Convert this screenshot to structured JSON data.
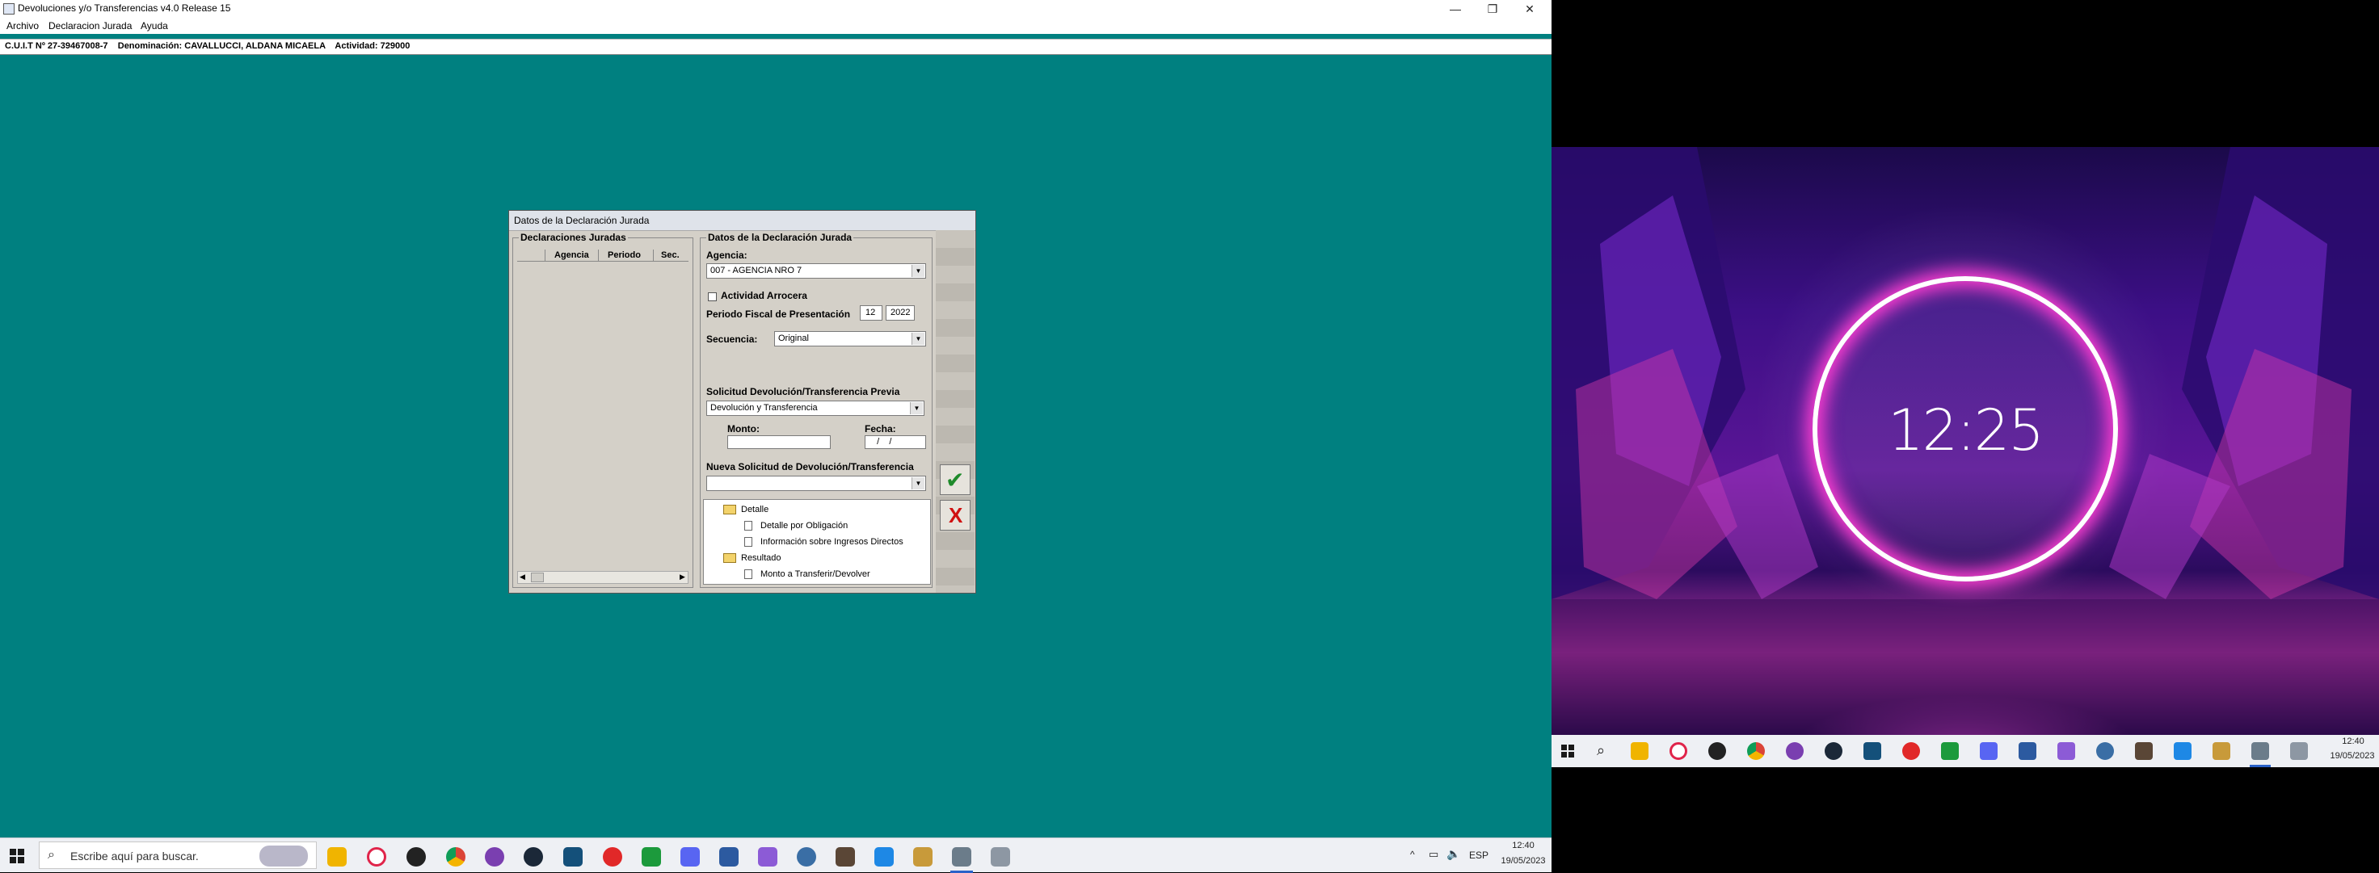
{
  "app": {
    "title": "Devoluciones y/o Transferencias v4.0 Release 15",
    "window_controls": [
      "—",
      "❐",
      "✕"
    ],
    "menu": [
      "Archivo",
      "Declaracion Jurada",
      "Ayuda"
    ],
    "infobar": "C.U.I.T Nº 27-39467008-7    Denominación: CAVALLUCCI, ALDANA MICAELA    Actividad: 729000"
  },
  "dialog": {
    "title": "Datos de la Declaración Jurada",
    "left_group": {
      "label": "Declaraciones Juradas",
      "columns": [
        "Agencia",
        "Periodo",
        "Sec."
      ]
    },
    "right_group": {
      "label": "Datos de la Declaración Jurada",
      "agencia_label": "Agencia:",
      "agencia_value": "007 - AGENCIA NRO 7",
      "actividad_arrocera_label": "Actividad Arrocera",
      "periodo_label": "Periodo Fiscal de Presentación",
      "periodo_month": "12",
      "periodo_year": "2022",
      "secuencia_label": "Secuencia:",
      "secuencia_value": "Original",
      "solicitud_previa_label": "Solicitud Devolución/Transferencia Previa",
      "solicitud_previa_value": "Devolución y Transferencia",
      "monto_label": "Monto:",
      "monto_value": "",
      "fecha_label": "Fecha:",
      "fecha_value": "  /    /",
      "nueva_solicitud_label": "Nueva Solicitud de Devolución/Transferencia",
      "nueva_solicitud_value": ""
    },
    "tree": [
      {
        "label": "Detalle",
        "type": "folder"
      },
      {
        "label": "Detalle por Obligación",
        "type": "doc"
      },
      {
        "label": "Información sobre Ingresos Directos",
        "type": "doc"
      },
      {
        "label": "Resultado",
        "type": "folder"
      },
      {
        "label": "Monto a Transferir/Devolver",
        "type": "doc"
      }
    ],
    "ok_glyph": "✔",
    "cancel_glyph": "X",
    "ok_color": "#1e8a2a",
    "cancel_color": "#d01010"
  },
  "taskbar_left": {
    "search_placeholder": "Escribe aquí para buscar.",
    "time": "12:40",
    "date": "19/05/2023",
    "lang": "ESP",
    "icons": [
      "file-explorer-icon",
      "opera-icon",
      "gog-icon",
      "chrome-icon",
      "proton-icon",
      "steam-icon",
      "book-icon",
      "red-app-icon",
      "spreadsheet-icon",
      "discord-icon",
      "virtualbox-icon",
      "purple-app-icon",
      "blue-app-icon",
      "game-icon",
      "vscode-icon",
      "folder-app-icon",
      "afip-icon",
      "network-app-icon"
    ]
  },
  "taskbar_right": {
    "time": "12:40",
    "date": "19/05/2023"
  },
  "wallpaper": {
    "clock": "12:25",
    "ring_color": "#ff3fd2"
  }
}
